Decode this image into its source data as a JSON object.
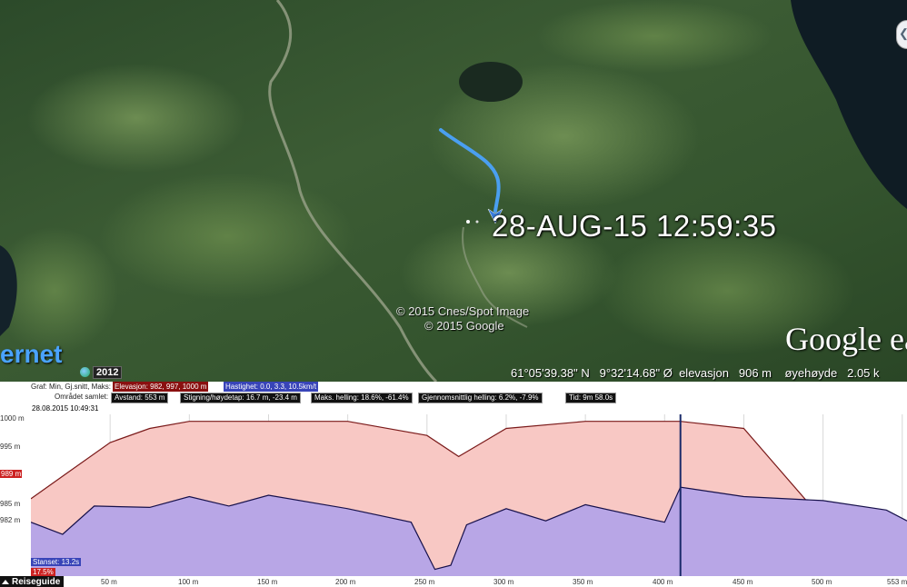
{
  "map": {
    "timestamp": "28-AUG-15 12:59:35",
    "copyright_lines": [
      "© 2015 Cnes/Spot Image",
      "© 2015 Google"
    ],
    "logo_text": "Google ea",
    "partial_label": "ernet",
    "year_badge": "2012",
    "status": {
      "latitude": "61°05'39.38\" N",
      "longitude": "9°32'14.68\" Ø",
      "elevation_label": "elevasjon",
      "elevation_value": "906 m",
      "eye_label": "øyehøyde",
      "eye_value": "2.05 k"
    },
    "colors": {
      "track": "#4a9ff0",
      "accent_text": "#4aa3ff"
    }
  },
  "profile": {
    "toolbar": {
      "graf_label": "Graf: Min, Gj.snitt, Maks:",
      "elevation": "Elevasjon: 982, 997, 1000 m",
      "speed": "Hastighet: 0.0, 3.3, 10.5km/t"
    },
    "stats": {
      "area": "Området samlet:",
      "distance": "Avstand: 553 m",
      "climb": "Stigning/høydetap: 16.7 m, -23.4 m",
      "max_slope": "Maks. helling: 18.6%, -61.4%",
      "avg_slope": "Gjennomsnittlig helling: 6.2%, -7.9%",
      "time": "Tid: 9m 58.0s"
    },
    "date_label": "28.08.2015 10:49:31",
    "stanset": "Stanset: 13.2s",
    "percent": "17.5%",
    "bottom_tab": "Reiseguide",
    "y_labels": [
      "1000 m",
      "995 m",
      "989 m",
      "985 m",
      "982 m"
    ],
    "x_labels": [
      "50 m",
      "100 m",
      "150 m",
      "200 m",
      "250 m",
      "300 m",
      "350 m",
      "400 m",
      "450 m",
      "500 m",
      "553 m"
    ],
    "colors": {
      "elevation_fill": "#f8c8c4",
      "elevation_line": "#7a1a1a",
      "speed_fill": "#b8a6e6",
      "speed_line": "#16104a",
      "highlight": "#c22222",
      "badge_blue": "#3844b8"
    }
  },
  "chart_data": {
    "type": "area",
    "x_unit": "m",
    "xlim": [
      0,
      553
    ],
    "series": [
      {
        "name": "Elevasjon",
        "x": [
          0,
          25,
          50,
          75,
          100,
          125,
          150,
          200,
          250,
          270,
          285,
          300,
          350,
          400,
          410,
          450,
          500,
          553
        ],
        "values": [
          989,
          993,
          997,
          999,
          1000,
          1000,
          1000,
          1000,
          998,
          995,
          997,
          999,
          1000,
          1000,
          1000,
          999,
          986,
          982
        ]
      },
      {
        "name": "Hastighet",
        "x": [
          0,
          20,
          40,
          75,
          100,
          125,
          150,
          200,
          240,
          255,
          265,
          275,
          300,
          325,
          350,
          400,
          410,
          450,
          500,
          540,
          553
        ],
        "values": [
          4.0,
          3.1,
          5.2,
          5.1,
          5.9,
          5.2,
          6.0,
          5.0,
          4.0,
          0.5,
          0.8,
          3.8,
          5.0,
          4.1,
          5.3,
          4.0,
          6.6,
          5.9,
          5.6,
          4.9,
          4.1
        ],
        "unit": "km/t"
      }
    ]
  }
}
